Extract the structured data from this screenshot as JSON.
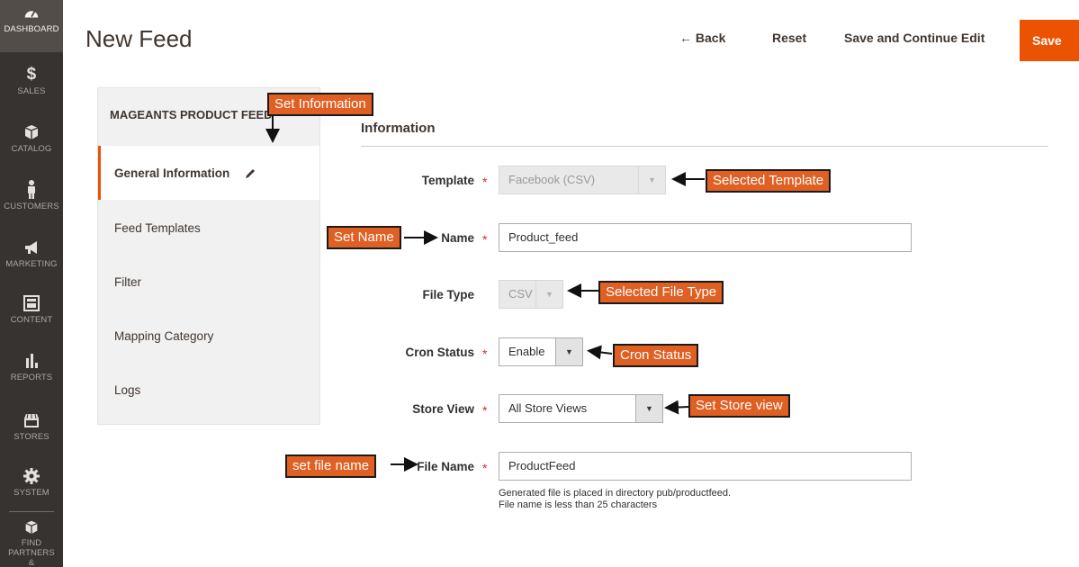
{
  "nav": {
    "dashboard": "DASHBOARD",
    "sales": "SALES",
    "catalog": "CATALOG",
    "customers": "CUSTOMERS",
    "marketing": "MARKETING",
    "content": "CONTENT",
    "reports": "REPORTS",
    "stores": "STORES",
    "system": "SYSTEM",
    "partners_line1": "FIND PARTNERS",
    "partners_line2": "& EXTENSIONS"
  },
  "header": {
    "title": "New Feed",
    "back": "← Back",
    "reset": "Reset",
    "save_continue": "Save and Continue Edit",
    "save": "Save"
  },
  "tabs": {
    "title": "MAGEANTS PRODUCT FEED",
    "items": [
      {
        "label": "General Information",
        "active": true
      },
      {
        "label": "Feed Templates"
      },
      {
        "label": "Filter"
      },
      {
        "label": "Mapping Category"
      },
      {
        "label": "Logs"
      }
    ]
  },
  "form": {
    "section_title": "Information",
    "template": {
      "label": "Template",
      "value": "Facebook (CSV)"
    },
    "name": {
      "label": "Name",
      "value": "Product_feed"
    },
    "file_type": {
      "label": "File Type",
      "value": "CSV"
    },
    "cron_status": {
      "label": "Cron Status",
      "value": "Enable"
    },
    "store_view": {
      "label": "Store View",
      "value": "All Store Views"
    },
    "file_name": {
      "label": "File Name",
      "value": "ProductFeed",
      "note_line1": "Generated file is placed in directory pub/productfeed.",
      "note_line2": "File name is less than 25 characters"
    },
    "required_mark": "*"
  },
  "annotations": {
    "set_information": "Set Information",
    "selected_template": "Selected Template",
    "set_name": "Set Name",
    "selected_file_type": "Selected File Type",
    "cron_status": "Cron Status",
    "set_store_view": "Set Store view",
    "set_file_name": "set file name"
  },
  "colors": {
    "nav_bg": "#373330",
    "accent": "#eb5202",
    "callout": "#e05f23"
  }
}
